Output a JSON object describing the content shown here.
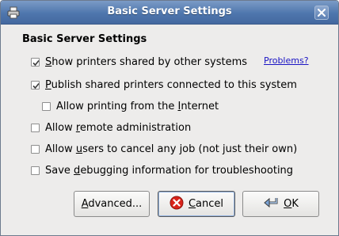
{
  "window": {
    "title": "Basic Server Settings",
    "icon": "printer-icon",
    "close_icon": "close-icon"
  },
  "dialog": {
    "heading": "Basic Server Settings",
    "options": [
      {
        "mnemonic": "S",
        "rest": "how printers shared by other systems",
        "checked": true
      },
      {
        "mnemonic": "P",
        "rest": "ublish shared printers connected to this system",
        "checked": true
      },
      {
        "before": "Allow printing from the ",
        "mnemonic": "I",
        "rest": "nternet",
        "checked": false
      },
      {
        "before": "Allow ",
        "mnemonic": "r",
        "rest": "emote administration",
        "checked": false
      },
      {
        "before": "Allow ",
        "mnemonic": "u",
        "rest": "sers to cancel any job (not just their own)",
        "checked": false
      },
      {
        "before": "Save ",
        "mnemonic": "d",
        "rest": "ebugging information for troubleshooting",
        "checked": false
      }
    ],
    "problems_link": "Problems?"
  },
  "buttons": {
    "advanced": {
      "mnemonic": "A",
      "rest": "dvanced..."
    },
    "cancel": {
      "mnemonic": "C",
      "rest": "ancel",
      "icon": "cancel-icon"
    },
    "ok": {
      "mnemonic": "O",
      "rest": "K",
      "icon": "ok-arrow-icon"
    }
  },
  "colors": {
    "titlebar": "#4e76ad",
    "link": "#1a14c4",
    "cancel_icon": "#d9231a"
  }
}
